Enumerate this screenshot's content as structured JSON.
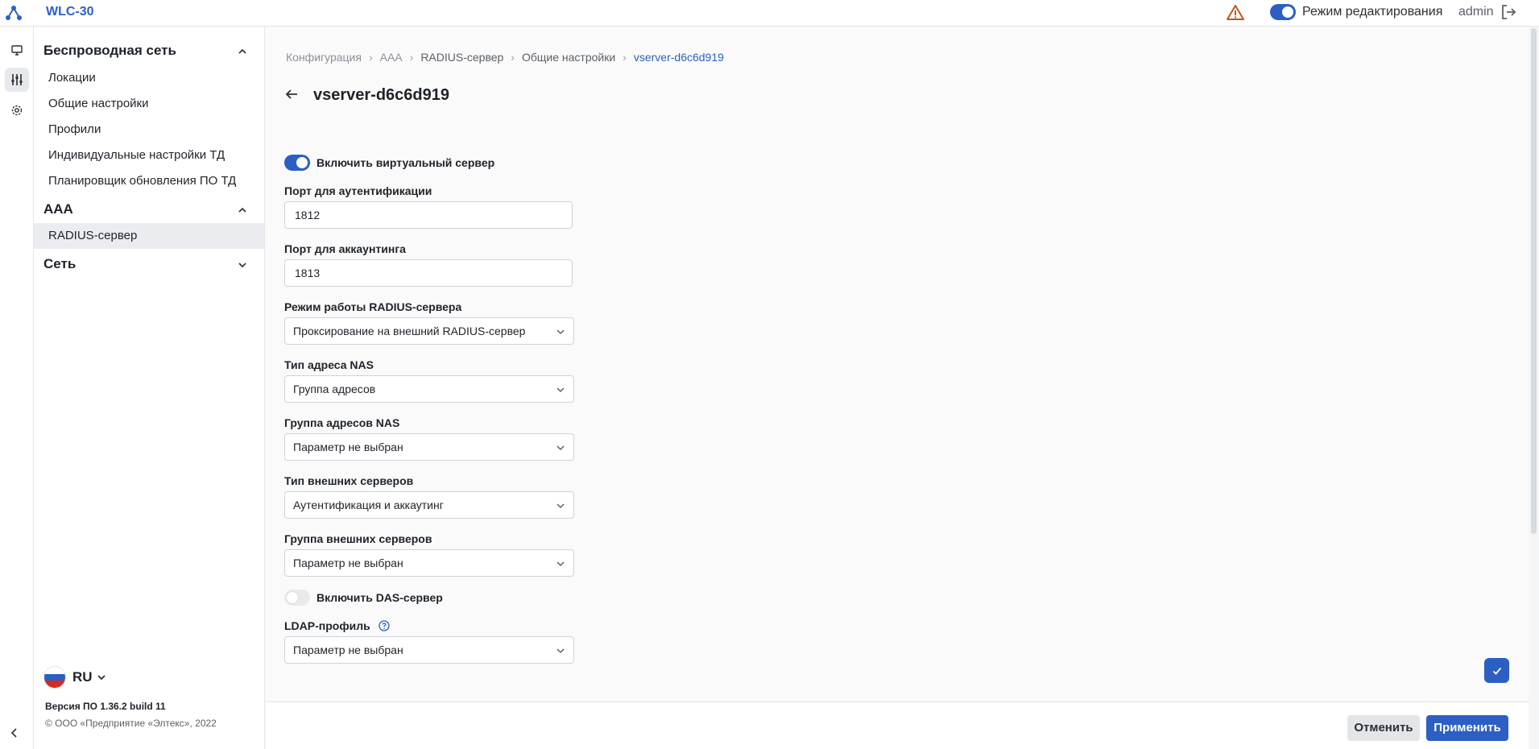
{
  "header": {
    "app_title": "WLC-30",
    "edit_mode_label": "Режим редактирования",
    "edit_mode_on": true,
    "user": "admin"
  },
  "rail": {
    "items": [
      {
        "icon": "monitor-icon"
      },
      {
        "icon": "sliders-icon",
        "active": true
      },
      {
        "icon": "gear-icon"
      }
    ]
  },
  "sidebar": {
    "sections": [
      {
        "title": "Беспроводная сеть",
        "expanded": true,
        "items": [
          "Локации",
          "Общие настройки",
          "Профили",
          "Индивидуальные настройки ТД",
          "Планировщик обновления ПО ТД"
        ]
      },
      {
        "title": "AAA",
        "expanded": true,
        "items": [
          "RADIUS-сервер"
        ],
        "active_item": "RADIUS-сервер"
      },
      {
        "title": "Сеть",
        "expanded": false,
        "items": []
      }
    ],
    "language": "RU",
    "version": "Версия ПО 1.36.2 build 11",
    "copyright": "© ООО «Предприятие «Элтекс», 2022"
  },
  "breadcrumb": [
    "Конфигурация",
    "AAA",
    "RADIUS-сервер",
    "Общие настройки",
    "vserver-d6c6d919"
  ],
  "page": {
    "title": "vserver-d6c6d919",
    "enable_vserver_label": "Включить виртуальный сервер",
    "enable_vserver_on": true,
    "auth_port_label": "Порт для аутентификации",
    "auth_port_value": "1812",
    "acct_port_label": "Порт для аккаунтинга",
    "acct_port_value": "1813",
    "mode_label": "Режим работы RADIUS-сервера",
    "mode_value": "Проксирование на внешний RADIUS-сервер",
    "nas_type_label": "Тип адреса NAS",
    "nas_type_value": "Группа адресов",
    "nas_group_label": "Группа адресов NAS",
    "nas_group_value": "Параметр не выбран",
    "ext_type_label": "Тип внешних серверов",
    "ext_type_value": "Аутентификация и аккаутинг",
    "ext_group_label": "Группа внешних серверов",
    "ext_group_value": "Параметр не выбран",
    "das_label": "Включить DAS-сервер",
    "das_on": false,
    "ldap_label": "LDAP-профиль",
    "ldap_value": "Параметр не выбран"
  },
  "footer": {
    "cancel_label": "Отменить",
    "apply_label": "Применить"
  },
  "colors": {
    "accent": "#2c5fc4",
    "warning": "#c0561a"
  }
}
